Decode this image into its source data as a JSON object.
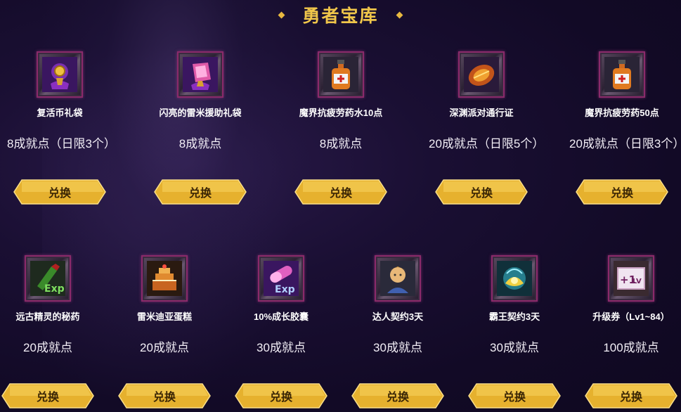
{
  "title": "勇者宝库",
  "exchange_label": "兑换",
  "row1": [
    {
      "name": "复活币礼袋",
      "cost": "8成就点（日限3个）",
      "icon": "coin-pouch-icon"
    },
    {
      "name": "闪亮的雷米援助礼袋",
      "cost": "8成就点",
      "icon": "pink-gift-pouch-icon"
    },
    {
      "name": "魔界抗疲劳药水10点",
      "cost": "8成就点",
      "icon": "potion-bottle-icon"
    },
    {
      "name": "深渊派对通行证",
      "cost": "20成就点（日限5个）",
      "icon": "abyss-pass-icon"
    },
    {
      "name": "魔界抗疲劳药50点",
      "cost": "20成就点（日限3个）",
      "icon": "potion-bottle-icon"
    }
  ],
  "row2": [
    {
      "name": "远古精灵的秘药",
      "cost": "20成就点",
      "icon": "exp-potion-icon"
    },
    {
      "name": "雷米迪亚蛋糕",
      "cost": "20成就点",
      "icon": "cake-icon"
    },
    {
      "name": "10%成长胶囊",
      "cost": "30成就点",
      "icon": "exp-capsule-icon"
    },
    {
      "name": "达人契约3天",
      "cost": "30成就点",
      "icon": "master-contract-icon"
    },
    {
      "name": "霸王契约3天",
      "cost": "30成就点",
      "icon": "overlord-contract-icon"
    },
    {
      "name": "升级券（Lv1~84）",
      "cost": "100成就点",
      "icon": "level-up-ticket-icon"
    }
  ],
  "colors": {
    "accent": "#f0c64a",
    "background": "#120a26",
    "button": "#e8b430"
  }
}
